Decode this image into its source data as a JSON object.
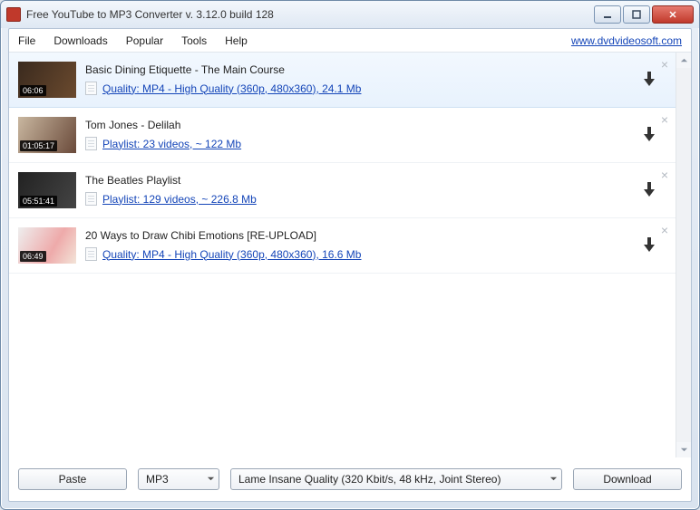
{
  "window": {
    "title": "Free YouTube to MP3 Converter  v. 3.12.0 build 128"
  },
  "menu": {
    "items": [
      "File",
      "Downloads",
      "Popular",
      "Tools",
      "Help"
    ],
    "site_link": "www.dvdvideosoft.com"
  },
  "items": [
    {
      "duration": "06:06",
      "title": "Basic Dining Etiquette - The Main Course",
      "detail": "Quality: MP4 - High Quality (360p, 480x360), 24.1 Mb",
      "selected": true
    },
    {
      "duration": "01:05:17",
      "title": "Tom Jones - Delilah",
      "detail": "Playlist: 23 videos, ~ 122 Mb",
      "selected": false
    },
    {
      "duration": "05:51:41",
      "title": "The Beatles Playlist",
      "detail": "Playlist: 129 videos, ~ 226.8 Mb",
      "selected": false
    },
    {
      "duration": "06:49",
      "title": "20 Ways to Draw Chibi Emotions [RE-UPLOAD]",
      "detail": "Quality: MP4 - High Quality (360p, 480x360), 16.6 Mb",
      "selected": false
    }
  ],
  "bottom": {
    "paste": "Paste",
    "format": "MP3",
    "quality": "Lame Insane Quality (320 Kbit/s, 48 kHz, Joint Stereo)",
    "download": "Download"
  }
}
